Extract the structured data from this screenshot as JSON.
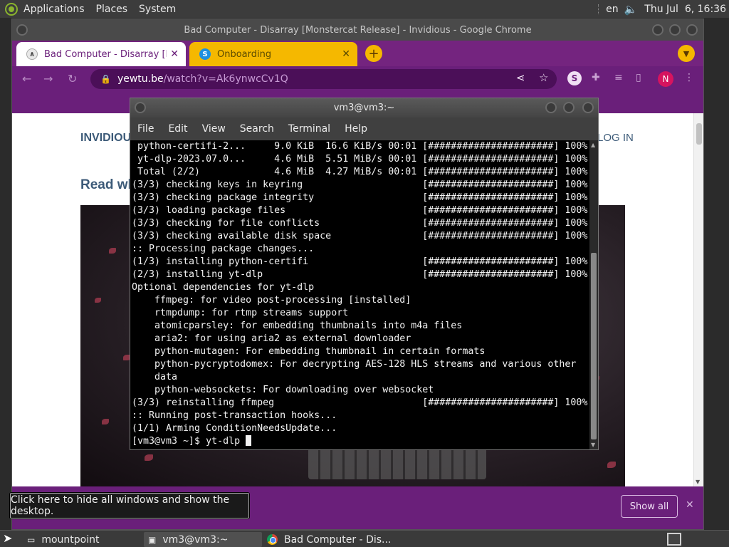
{
  "top_panel": {
    "menus": [
      "Applications",
      "Places",
      "System"
    ],
    "keyboard_layout": "en",
    "clock": "Thu Jul  6, 16:36"
  },
  "chrome": {
    "window_title": "Bad Computer - Disarray [Monstercat Release] - Invidious - Google Chrome",
    "tabs": [
      {
        "label": "Bad Computer - Disarray [Monstercat Release] - Invidious",
        "active": true,
        "icon": "invidious-icon"
      },
      {
        "label": "Onboarding",
        "active": false,
        "icon": "stylus-s-icon"
      }
    ],
    "new_tab_label": "+",
    "url_host": "yewtu.be",
    "url_path": "/watch?v=Ak6ynwcCv1Q",
    "profile_initial": "N",
    "extension_s_label": "S",
    "accent_color": "#6a1f7a",
    "tab2_color": "#f5b800"
  },
  "page": {
    "brand": "INVIDIOUS",
    "login_label": "LOG IN",
    "heading": "Read wh"
  },
  "terminal": {
    "title": "vm3@vm3:~",
    "menu": [
      "File",
      "Edit",
      "View",
      "Search",
      "Terminal",
      "Help"
    ],
    "lines": [
      " python-certifi-2...     9.0 KiB  16.6 KiB/s 00:01 [######################] 100%",
      " yt-dlp-2023.07.0...     4.6 MiB  5.51 MiB/s 00:01 [######################] 100%",
      " Total (2/2)             4.6 MiB  4.27 MiB/s 00:01 [######################] 100%",
      "(3/3) checking keys in keyring                     [######################] 100%",
      "(3/3) checking package integrity                   [######################] 100%",
      "(3/3) loading package files                        [######################] 100%",
      "(3/3) checking for file conflicts                  [######################] 100%",
      "(3/3) checking available disk space                [######################] 100%",
      ":: Processing package changes...",
      "(1/3) installing python-certifi                    [######################] 100%",
      "(2/3) installing yt-dlp                            [######################] 100%",
      "Optional dependencies for yt-dlp",
      "    ffmpeg: for video post-processing [installed]",
      "    rtmpdump: for rtmp streams support",
      "    atomicparsley: for embedding thumbnails into m4a files",
      "    aria2: for using aria2 as external downloader",
      "    python-mutagen: For embedding thumbnail in certain formats",
      "    python-pycryptodomex: For decrypting AES-128 HLS streams and various other",
      "    data",
      "    python-websockets: For downloading over websocket",
      "(3/3) reinstalling ffmpeg                          [######################] 100%",
      ":: Running post-transaction hooks...",
      "(1/1) Arming ConditionNeedsUpdate..."
    ],
    "prompt": "[vm3@vm3 ~]$ ",
    "command": "yt-dlp "
  },
  "downloads_bar": {
    "show_all_label": "Show all",
    "close_label": "✕"
  },
  "tooltip": "Click here to hide all windows and show the desktop.",
  "taskbar": {
    "tasks": [
      {
        "label": "mountpoint",
        "icon": "window-icon"
      },
      {
        "label": "vm3@vm3:~",
        "icon": "terminal-icon"
      },
      {
        "label": "Bad Computer - Dis...",
        "icon": "chrome-icon"
      }
    ]
  }
}
